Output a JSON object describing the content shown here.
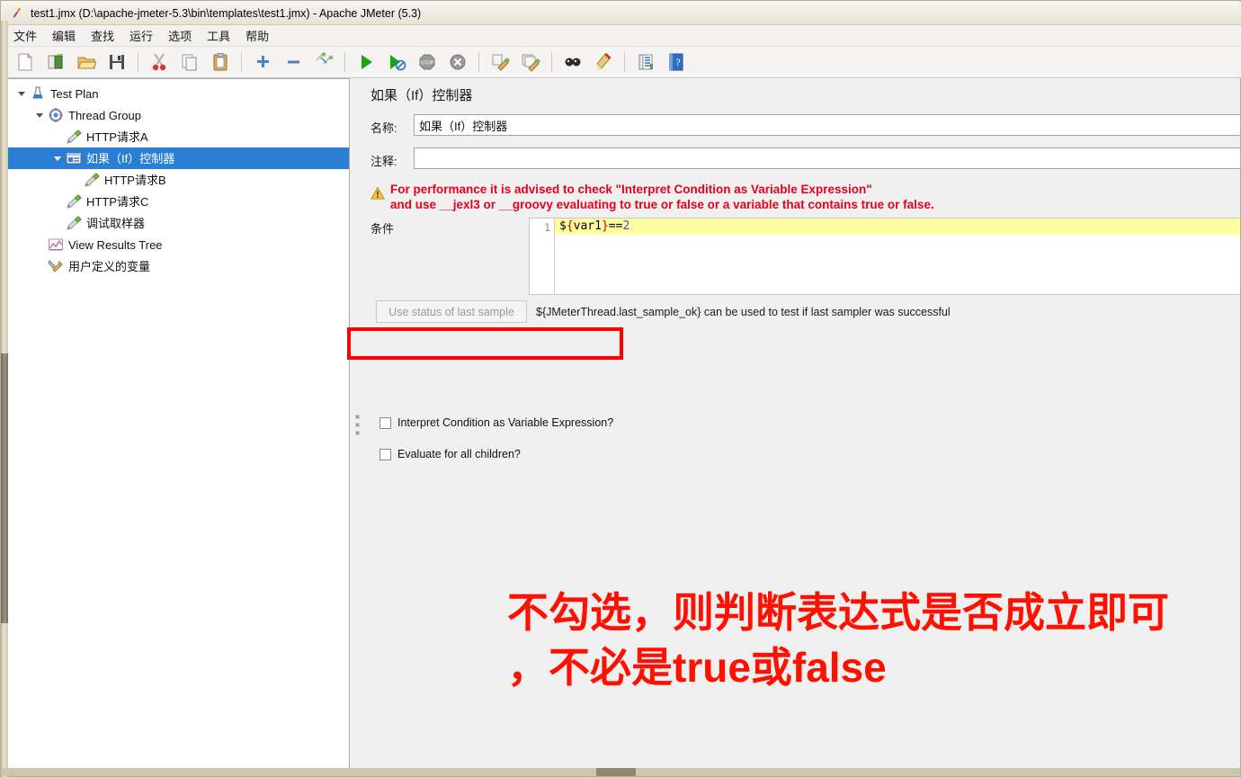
{
  "window": {
    "title": "test1.jmx (D:\\apache-jmeter-5.3\\bin\\templates\\test1.jmx) - Apache JMeter (5.3)",
    "app_icon": "jmeter-feather-icon"
  },
  "menubar": {
    "items": [
      {
        "label": "文件",
        "name": "menu-file"
      },
      {
        "label": "编辑",
        "name": "menu-edit"
      },
      {
        "label": "查找",
        "name": "menu-search"
      },
      {
        "label": "运行",
        "name": "menu-run"
      },
      {
        "label": "选项",
        "name": "menu-options"
      },
      {
        "label": "工具",
        "name": "menu-tools"
      },
      {
        "label": "帮助",
        "name": "menu-help"
      }
    ]
  },
  "toolbar": {
    "buttons": [
      {
        "name": "new-icon",
        "tip": "New"
      },
      {
        "name": "templates-icon",
        "tip": "Templates"
      },
      {
        "name": "open-icon",
        "tip": "Open"
      },
      {
        "name": "save-icon",
        "tip": "Save"
      },
      {
        "sep": true
      },
      {
        "name": "cut-icon",
        "tip": "Cut"
      },
      {
        "name": "copy-icon",
        "tip": "Copy"
      },
      {
        "name": "paste-icon",
        "tip": "Paste"
      },
      {
        "sep": true
      },
      {
        "name": "expand-all-icon",
        "tip": "Expand All"
      },
      {
        "name": "collapse-all-icon",
        "tip": "Collapse All"
      },
      {
        "name": "toggle-icon",
        "tip": "Toggle"
      },
      {
        "sep": true
      },
      {
        "name": "start-icon",
        "tip": "Start"
      },
      {
        "name": "start-no-timers-icon",
        "tip": "Start no pauses"
      },
      {
        "name": "stop-icon",
        "tip": "Stop"
      },
      {
        "name": "shutdown-icon",
        "tip": "Shutdown"
      },
      {
        "sep": true
      },
      {
        "name": "clear-icon",
        "tip": "Clear"
      },
      {
        "name": "clear-all-icon",
        "tip": "Clear All"
      },
      {
        "sep": true
      },
      {
        "name": "search-icon",
        "tip": "Search"
      },
      {
        "name": "reset-search-icon",
        "tip": "Reset Search"
      },
      {
        "sep": true
      },
      {
        "name": "function-helper-icon",
        "tip": "Function Helper Dialog"
      },
      {
        "name": "help-icon",
        "tip": "Help"
      }
    ]
  },
  "tree": {
    "nodes": [
      {
        "label": "Test Plan",
        "icon": "test-plan-icon",
        "depth": 0,
        "twist": "down",
        "selected": false
      },
      {
        "label": "Thread Group",
        "icon": "thread-group-icon",
        "depth": 1,
        "twist": "down",
        "selected": false
      },
      {
        "label": "HTTP请求A",
        "icon": "http-sampler-icon",
        "depth": 2,
        "twist": "none",
        "selected": false
      },
      {
        "label": "如果（If）控制器",
        "icon": "if-controller-icon",
        "depth": 2,
        "twist": "down",
        "selected": true
      },
      {
        "label": "HTTP请求B",
        "icon": "http-sampler-icon",
        "depth": 3,
        "twist": "none",
        "selected": false
      },
      {
        "label": "HTTP请求C",
        "icon": "http-sampler-icon",
        "depth": 2,
        "twist": "none",
        "selected": false
      },
      {
        "label": "调试取样器",
        "icon": "debug-sampler-icon",
        "depth": 2,
        "twist": "none",
        "selected": false
      },
      {
        "label": "View Results Tree",
        "icon": "view-results-tree-icon",
        "depth": 1,
        "twist": "none",
        "selected": false
      },
      {
        "label": "用户定义的变量",
        "icon": "user-variables-icon",
        "depth": 1,
        "twist": "none",
        "selected": false
      }
    ]
  },
  "panel": {
    "title": "如果（If）控制器",
    "name_label": "名称:",
    "name_value": "如果（If）控制器",
    "comment_label": "注释:",
    "comment_value": "",
    "warning_line1": "For performance it is advised to check \"Interpret Condition as Variable Expression\"",
    "warning_line2": "and use __jexl3 or __groovy evaluating to true or false or a variable that contains true or false.",
    "warning_icon": "warning-triangle-icon",
    "condition_label": "条件",
    "condition_gutter": "1",
    "condition_code": {
      "dollar": "$",
      "open_brace": "{",
      "var": "var1",
      "close_brace": "}",
      "operator": "==",
      "number": "2"
    },
    "last_sample_button": "Use status of last sample",
    "last_sample_hint": "${JMeterThread.last_sample_ok} can be used to test if last sampler was successful",
    "checkboxes": [
      {
        "label": "Interpret Condition as Variable Expression?",
        "checked": false,
        "name": "interpret-condition-checkbox"
      },
      {
        "label": "Evaluate for all children?",
        "checked": false,
        "name": "evaluate-all-children-checkbox"
      }
    ]
  },
  "annotation": {
    "line1": "不勾选，则判断表达式是否成立即可",
    "line2": "，不必是true或false",
    "color": "#ff1000",
    "highlight_box_color": "#ff0000"
  },
  "colors": {
    "selection_blue": "#2a7fd4",
    "warning_red": "#e8001c",
    "code_highlight_yellow": "#ffffa0",
    "panel_bg": "#f0f0f0",
    "titlebar_bg": "#eeebe2"
  }
}
